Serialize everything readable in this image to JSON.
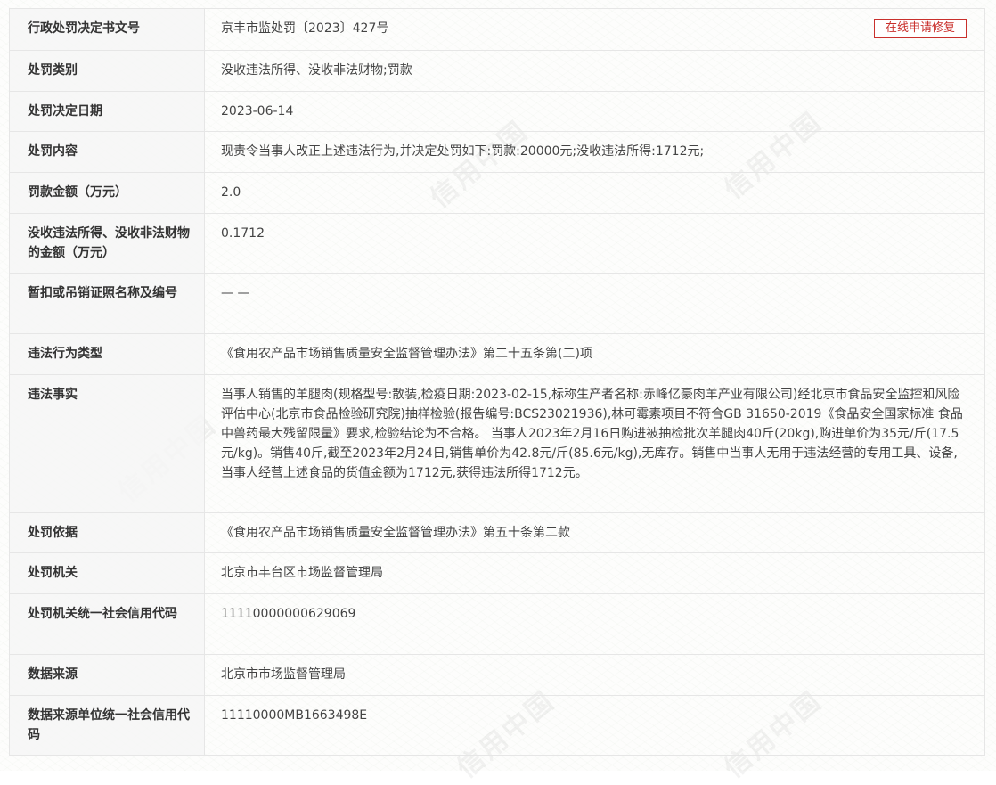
{
  "repair_button": "在线申请修复",
  "watermark": "信用中国",
  "accent_color": "#c9302c",
  "rows": [
    {
      "label": "行政处罚决定书文号",
      "value": "京丰市监处罚〔2023〕427号"
    },
    {
      "label": "处罚类别",
      "value": "没收违法所得、没收非法财物;罚款"
    },
    {
      "label": "处罚决定日期",
      "value": "2023-06-14"
    },
    {
      "label": "处罚内容",
      "value": "现责令当事人改正上述违法行为,并决定处罚如下:罚款:20000元;没收违法所得:1712元;"
    },
    {
      "label": "罚款金额（万元）",
      "value": "2.0"
    },
    {
      "label": "没收违法所得、没收非法财物的金额（万元）",
      "value": "0.1712"
    },
    {
      "label": "暂扣或吊销证照名称及编号",
      "value": "— —"
    },
    {
      "label": "违法行为类型",
      "value": "《食用农产品市场销售质量安全监督管理办法》第二十五条第(二)项"
    },
    {
      "label": "违法事实",
      "value": "当事人销售的羊腿肉(规格型号:散装,检疫日期:2023-02-15,标称生产者名称:赤峰亿豪肉羊产业有限公司)经北京市食品安全监控和风险评估中心(北京市食品检验研究院)抽样检验(报告编号:BCS23021936),林可霉素项目不符合GB 31650-2019《食品安全国家标准 食品中兽药最大残留限量》要求,检验结论为不合格。 当事人2023年2月16日购进被抽检批次羊腿肉40斤(20kg),购进单价为35元/斤(17.5元/kg)。销售40斤,截至2023年2月24日,销售单价为42.8元/斤(85.6元/kg),无库存。销售中当事人无用于违法经营的专用工具、设备,当事人经营上述食品的货值金额为1712元,获得违法所得1712元。"
    },
    {
      "label": "处罚依据",
      "value": "《食用农产品市场销售质量安全监督管理办法》第五十条第二款"
    },
    {
      "label": "处罚机关",
      "value": "北京市丰台区市场监督管理局"
    },
    {
      "label": "处罚机关统一社会信用代码",
      "value": "11110000000629069"
    },
    {
      "label": "数据来源",
      "value": "北京市市场监督管理局"
    },
    {
      "label": "数据来源单位统一社会信用代码",
      "value": "11110000MB1663498E"
    }
  ]
}
